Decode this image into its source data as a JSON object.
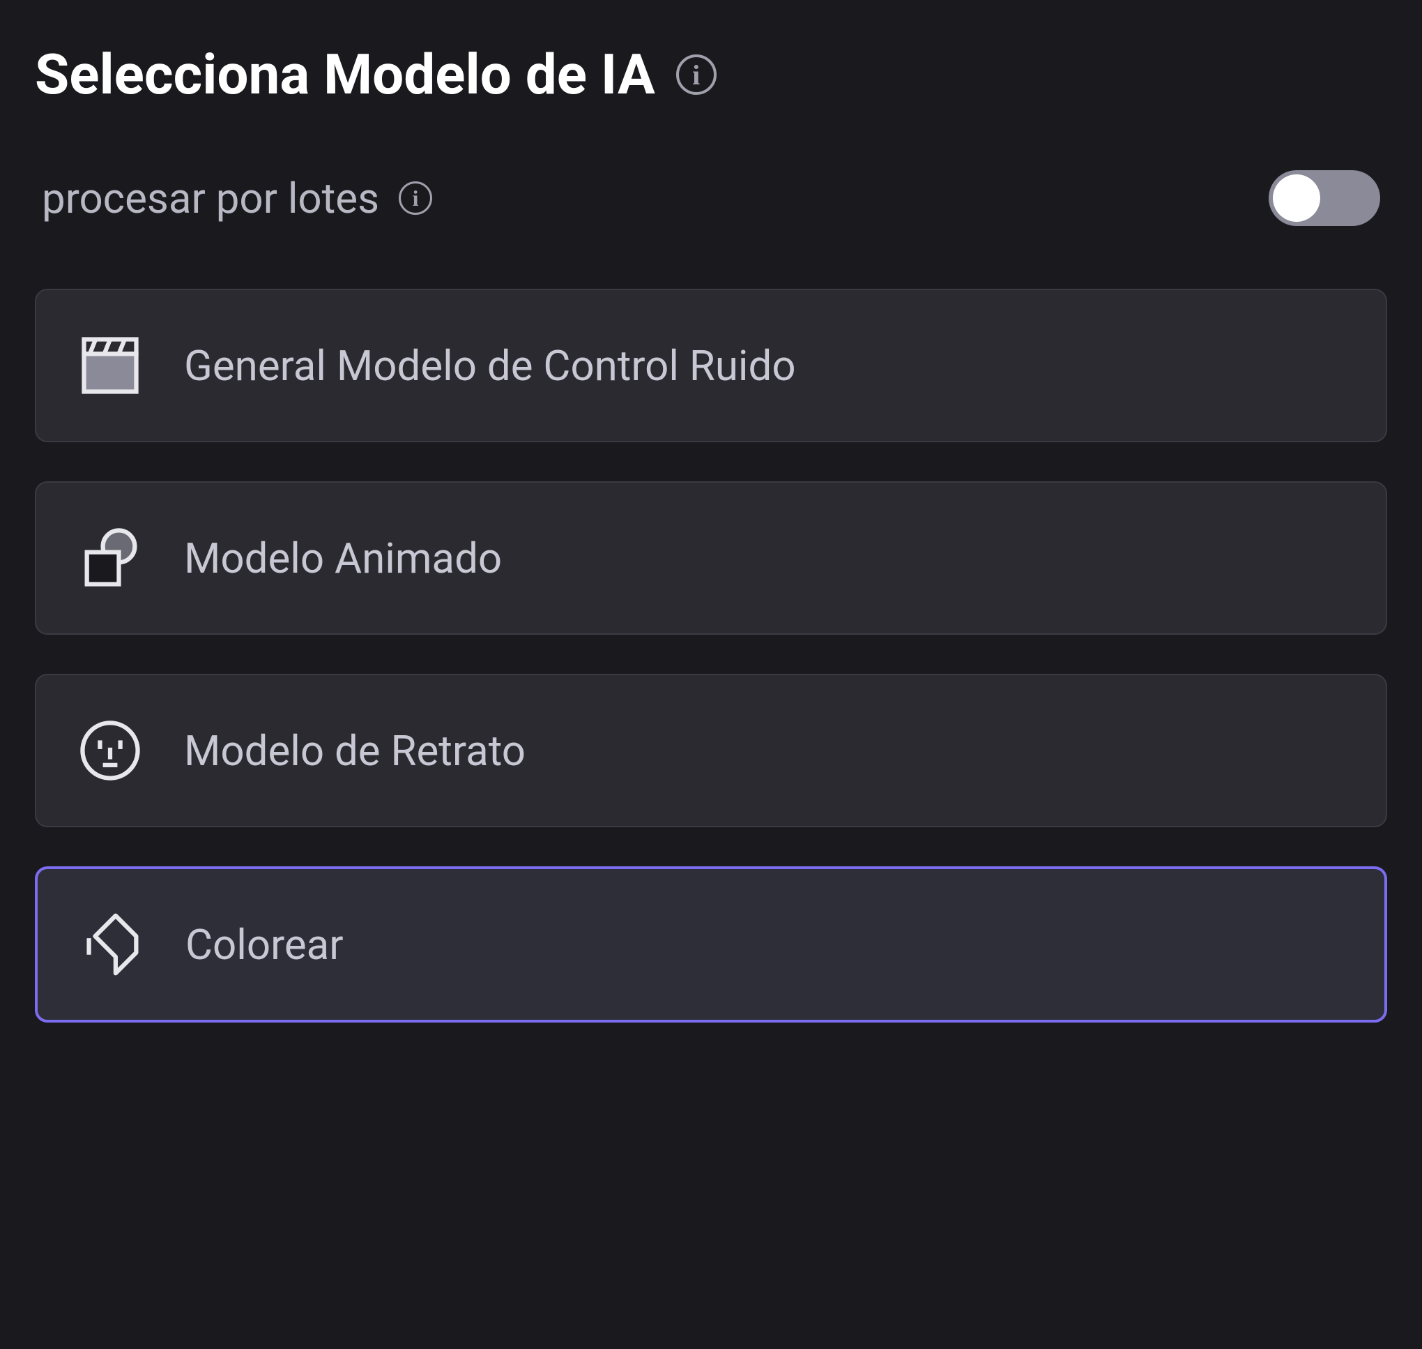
{
  "panel": {
    "title": "Selecciona Modelo de IA"
  },
  "batch": {
    "label": "procesar por lotes",
    "enabled": false
  },
  "models": [
    {
      "label": "General Modelo de Control Ruido",
      "icon": "clapperboard-icon",
      "selected": false
    },
    {
      "label": "Modelo Animado",
      "icon": "shapes-icon",
      "selected": false
    },
    {
      "label": "Modelo de Retrato",
      "icon": "face-icon",
      "selected": false
    },
    {
      "label": "Colorear",
      "icon": "paintbrush-icon",
      "selected": true
    }
  ],
  "colors": {
    "accent": "#7c6cf0",
    "background": "#1a1a1e",
    "card": "#2a2a30"
  }
}
